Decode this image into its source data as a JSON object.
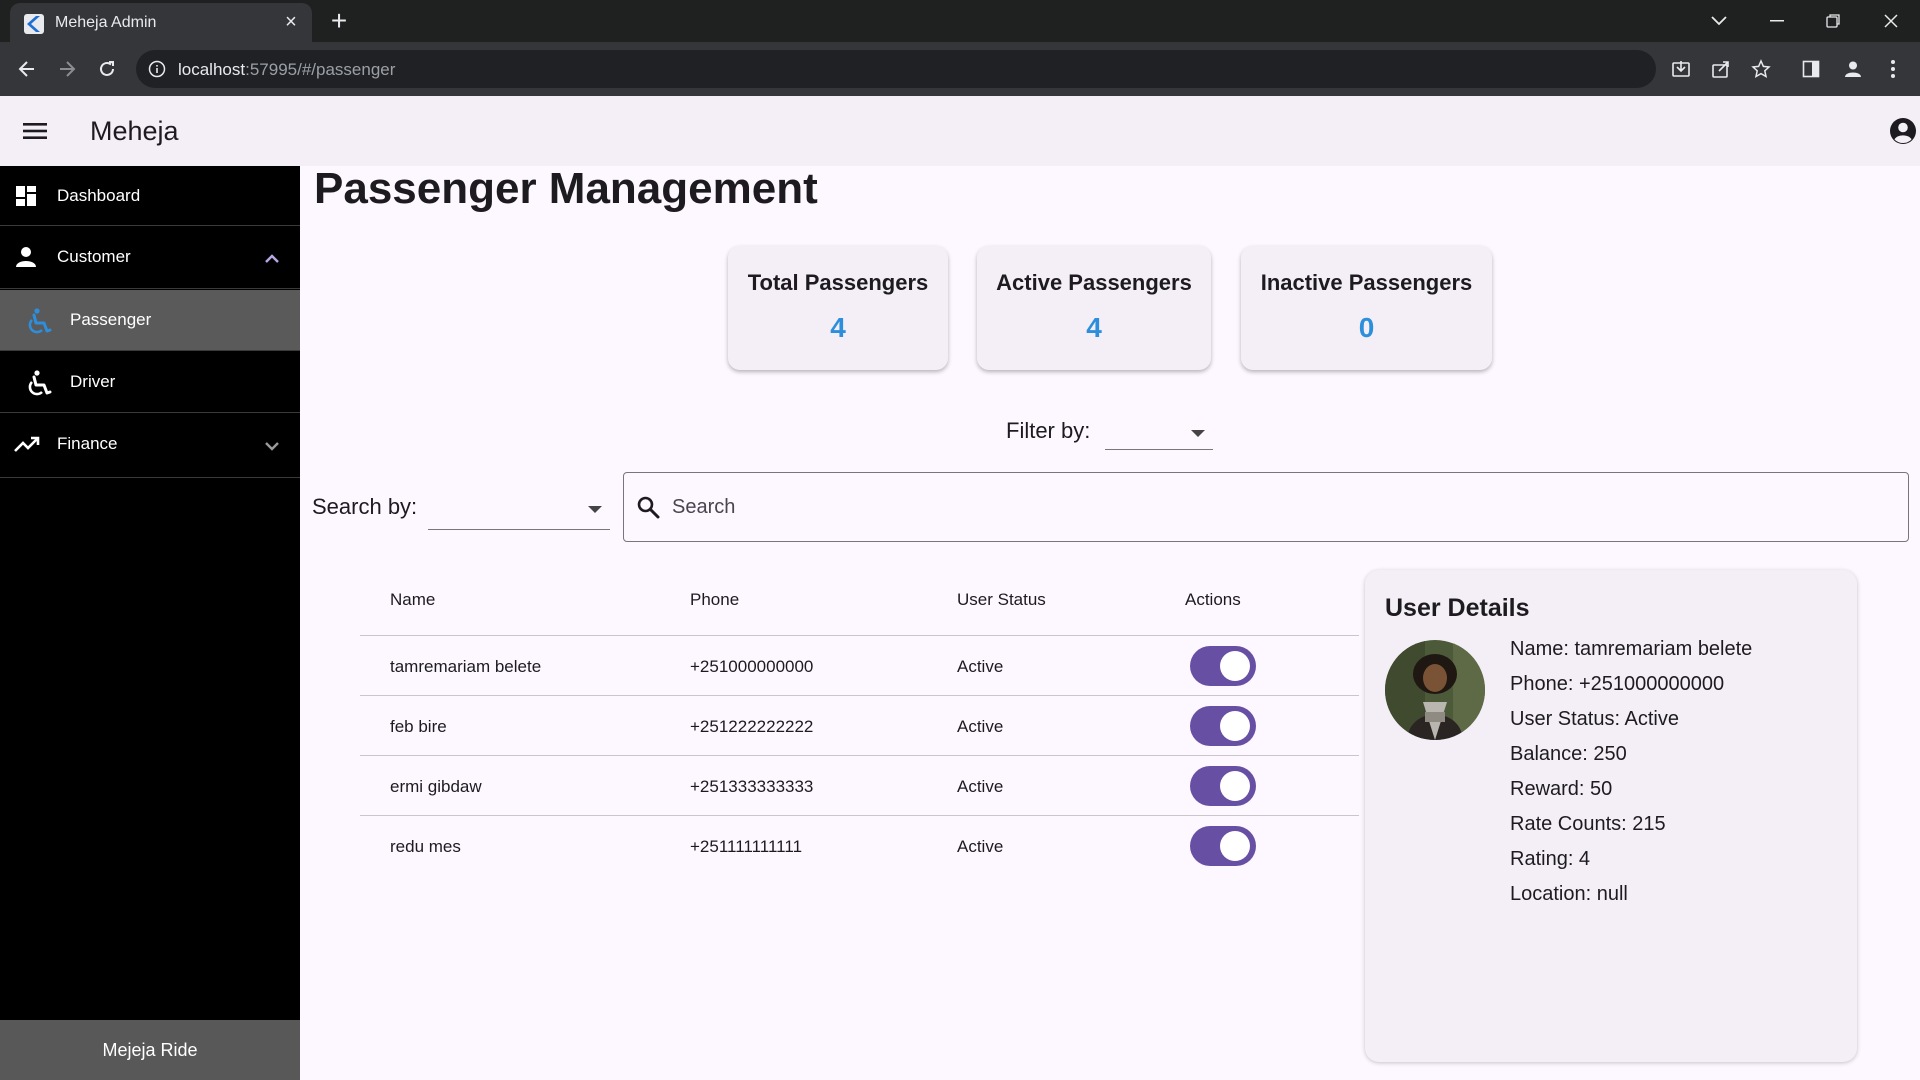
{
  "browser": {
    "tab_title": "Meheja Admin",
    "url_host": "localhost",
    "url_rest": ":57995/#/passenger"
  },
  "app": {
    "title": "Meheja"
  },
  "sidebar": {
    "items": [
      {
        "label": "Dashboard",
        "icon": "dashboard-icon"
      },
      {
        "label": "Customer",
        "icon": "person-icon",
        "expanded": true
      },
      {
        "label": "Passenger",
        "icon": "accessible-icon",
        "selected": true
      },
      {
        "label": "Driver",
        "icon": "accessible-icon"
      },
      {
        "label": "Finance",
        "icon": "trending-up-icon",
        "expanded": false
      }
    ],
    "footer": "Mejeja Ride"
  },
  "page": {
    "title": "Passenger Management"
  },
  "stats": [
    {
      "label": "Total Passengers",
      "value": "4"
    },
    {
      "label": "Active Passengers",
      "value": "4"
    },
    {
      "label": "Inactive Passengers",
      "value": "0"
    }
  ],
  "filter": {
    "label": "Filter by:",
    "value": ""
  },
  "search": {
    "label": "Search by:",
    "by_value": "",
    "placeholder": "Search"
  },
  "table": {
    "headers": [
      "Name",
      "Phone",
      "User Status",
      "Actions"
    ],
    "rows": [
      {
        "name": "tamremariam belete",
        "phone": "+251000000000",
        "status": "Active",
        "enabled": true
      },
      {
        "name": "feb bire",
        "phone": "+251222222222",
        "status": "Active",
        "enabled": true
      },
      {
        "name": "ermi gibdaw",
        "phone": "+251333333333",
        "status": "Active",
        "enabled": true
      },
      {
        "name": "redu mes",
        "phone": "+251111111111",
        "status": "Active",
        "enabled": true
      }
    ]
  },
  "details": {
    "title": "User Details",
    "lines": [
      "Name: tamremariam belete",
      "Phone: +251000000000",
      "User Status: Active",
      "Balance: 250",
      "Reward: 50",
      "Rate Counts: 215",
      "Rating: 4",
      "Location: null"
    ]
  },
  "colors": {
    "accent": "#6750a4",
    "stat_value": "#2d8fdc",
    "sidebar_bg": "#000000",
    "sidebar_selected": "#5a5a5a"
  }
}
